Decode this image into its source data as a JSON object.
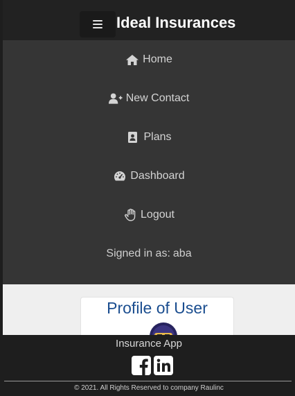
{
  "navbar": {
    "brand": "Ideal Insurances",
    "toggler_icon": "hamburger-icon"
  },
  "menu": {
    "items": [
      {
        "label": "Home",
        "icon": "home-icon"
      },
      {
        "label": "New Contact",
        "icon": "user-plus-icon"
      },
      {
        "label": "Plans",
        "icon": "contact-card-icon"
      },
      {
        "label": "Dashboard",
        "icon": "gauge-icon"
      },
      {
        "label": "Logout",
        "icon": "hand-wave-icon"
      }
    ],
    "signed_in_prefix": "Signed in as:",
    "signed_in_user": "aba"
  },
  "profile": {
    "title": "Profile of User",
    "avatar_icon": "avatar"
  },
  "footer": {
    "title": "Insurance App",
    "social": [
      "facebook-icon",
      "linkedin-icon"
    ],
    "copyright": "© 2021. All Rights Reserved to company Raulinc"
  },
  "colors": {
    "navbar_bg": "#222222",
    "menu_bg": "#353535",
    "content_bg": "#efefef",
    "profile_title": "#1a4d8f",
    "footer_bg": "#1e1e1e"
  }
}
